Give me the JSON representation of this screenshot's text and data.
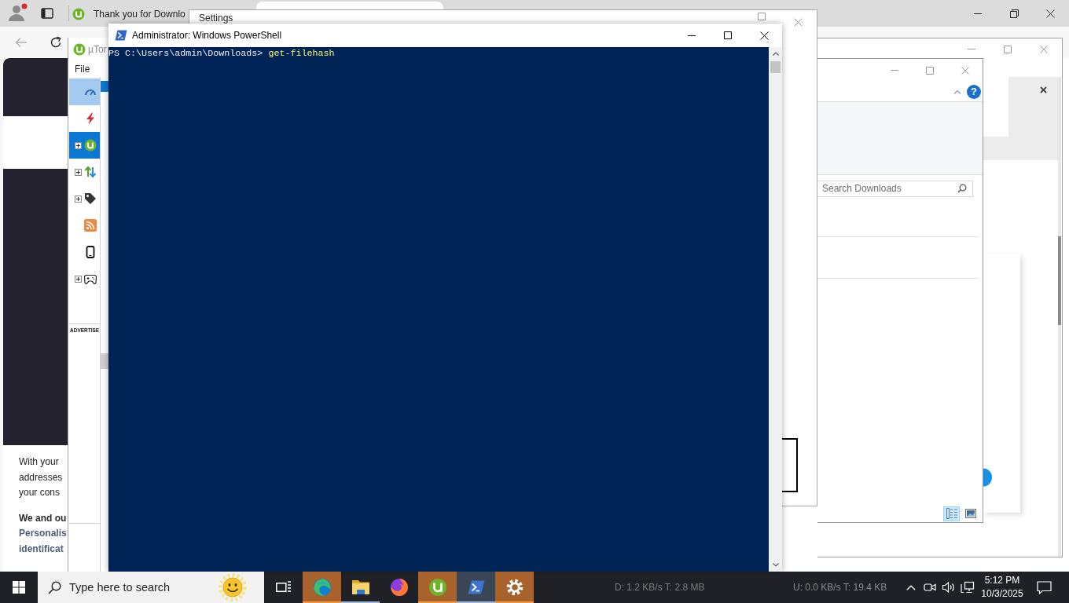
{
  "browser": {
    "tabs": [
      {
        "title": "Thank you for Downlo",
        "selected": false
      },
      {
        "selected": true
      }
    ],
    "back": {
      "disabled": true
    },
    "page": {
      "lines": [
        {
          "kind": "body",
          "text": "With your"
        },
        {
          "kind": "body",
          "text": "addresses"
        },
        {
          "kind": "body",
          "text": "your cons"
        },
        {
          "kind": "heading",
          "text": "We and ou"
        },
        {
          "kind": "link",
          "text": "Personalis"
        },
        {
          "kind": "link",
          "text": "identificat"
        }
      ]
    }
  },
  "explorer": {
    "help": "?",
    "search": {
      "placeholder": "Search Downloads"
    },
    "views": [
      {
        "kind": "details",
        "selected": true
      },
      {
        "kind": "large-icons",
        "selected": false
      }
    ]
  },
  "settings": {
    "title": "Settings"
  },
  "utorrent": {
    "title": "µTor",
    "menu": [
      "File"
    ],
    "sidebar": [
      {
        "kind": "speed",
        "has_children": false,
        "selected": false,
        "hover": true
      },
      {
        "kind": "bolt",
        "has_children": false,
        "selected": false,
        "hover": false
      },
      {
        "kind": "torrents",
        "has_children": true,
        "selected": true,
        "hover": false
      },
      {
        "kind": "transfer",
        "has_children": true,
        "selected": false,
        "hover": false
      },
      {
        "kind": "label",
        "has_children": true,
        "selected": false,
        "hover": false
      },
      {
        "kind": "rss",
        "has_children": false,
        "selected": false,
        "hover": false
      },
      {
        "kind": "device",
        "has_children": false,
        "selected": false,
        "hover": false
      },
      {
        "kind": "games",
        "has_children": true,
        "selected": false,
        "hover": false
      }
    ],
    "torrents": [
      {
        "selected": true
      }
    ],
    "ad_label": "ADVERTISE",
    "status": [
      "D: 1.2 KB/s T: 2.8 MB",
      "U: 0.0 KB/s T: 19.4 KB"
    ]
  },
  "powershell": {
    "title": "Administrator: Windows PowerShell",
    "lines": [
      {
        "prompt": "PS C:\\Users\\admin\\Downloads> ",
        "command": "get-filehash"
      }
    ]
  },
  "taskbar": {
    "search": {
      "placeholder": "Type here to search"
    },
    "apps": [
      {
        "kind": "task-view",
        "flashing": false,
        "selected": false,
        "running": false
      },
      {
        "kind": "edge",
        "flashing": true,
        "selected": false,
        "running": true
      },
      {
        "kind": "explorer",
        "flashing": false,
        "selected": false,
        "running": true
      },
      {
        "kind": "firefox",
        "flashing": false,
        "selected": false,
        "running": false
      },
      {
        "kind": "utorrent",
        "flashing": true,
        "selected": false,
        "running": true
      },
      {
        "kind": "powershell",
        "flashing": false,
        "selected": true,
        "running": true
      },
      {
        "kind": "settings",
        "flashing": true,
        "selected": false,
        "running": true
      }
    ],
    "clock": {
      "time": "5:12 PM",
      "date": "10/3/2025"
    }
  }
}
